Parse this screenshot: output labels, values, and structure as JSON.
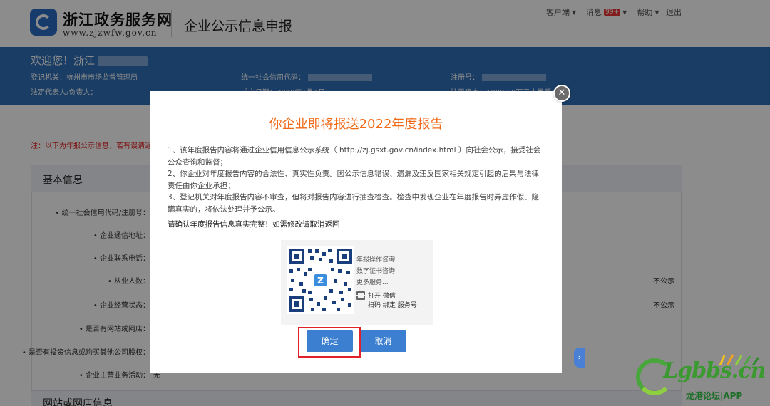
{
  "header": {
    "site_name": "浙江政务服务网",
    "site_url": "www.zjzwfw.gov.cn",
    "app_title": "企业公示信息申报",
    "nav": {
      "client": "客户端",
      "messages": "消息",
      "messages_badge": "99+",
      "help": "帮助",
      "logout": "退出"
    }
  },
  "banner": {
    "welcome": "欢迎您！浙江",
    "registration_authority": "登记机关：杭州市市场监督管理局",
    "legal_rep": "法定代表人/负责人：",
    "credit_code_label": "统一社会信用代码：",
    "established": "成立日期：2019年1月1日",
    "reg_no_label": "注册号：",
    "reg_capital": "注册资本：1000.00万元人民币"
  },
  "page": {
    "notice": "注：以下为年报公示信息，若有误请返回X",
    "section_title": "基本信息",
    "fields": [
      "• 统一社会信用代码/注册号：",
      "• 企业通信地址：",
      "• 企业联系电话：",
      "• 从业人数：",
      "• 企业经营状态：",
      "• 是否有网站或网店：",
      "• 是否有投资信息或购买其他公司股权：",
      "• 企业主营业务活动："
    ],
    "not_public": [
      "不公示",
      "不公示"
    ],
    "activity_value": "无",
    "section2_title": "网站或网店信息"
  },
  "dialog": {
    "title": "你企业即将报送2022年度报告",
    "paragraphs": [
      "1、该年度报告内容将通过企业信用信息公示系统（ http://zj.gsxt.gov.cn/index.html ）向社会公示，接受社会公众查询和监督；",
      "2、你企业对年度报告内容的合法性、真实性负责。因公示信息错误、遗漏及违反国家相关规定引起的后果与法律责任由你企业承担；",
      "3、登记机关对年度报告内容不审查，但将对报告内容进行抽查检查。检查中发现企业在年度报告时弄虚作假、隐瞒真实的，将依法处理并予公示。"
    ],
    "confirm_text": "请确认年度报告信息真实完整！如需修改请取消返回",
    "qr": {
      "lines": [
        "年报操作咨询",
        "数字证书咨询",
        "更多服务..."
      ],
      "scan_line1": "打开 微信",
      "scan_line2": "扫码 绑定 服务号"
    },
    "ok_label": "确定",
    "cancel_label": "取消"
  },
  "watermark": {
    "text": "Lgbbs.cn",
    "sub": "龙港论坛|APP"
  },
  "colors": {
    "banner": "#2f6fb8",
    "title_orange": "#f06a18",
    "button_blue": "#3c7fd0",
    "highlight_red": "#e0202a"
  }
}
